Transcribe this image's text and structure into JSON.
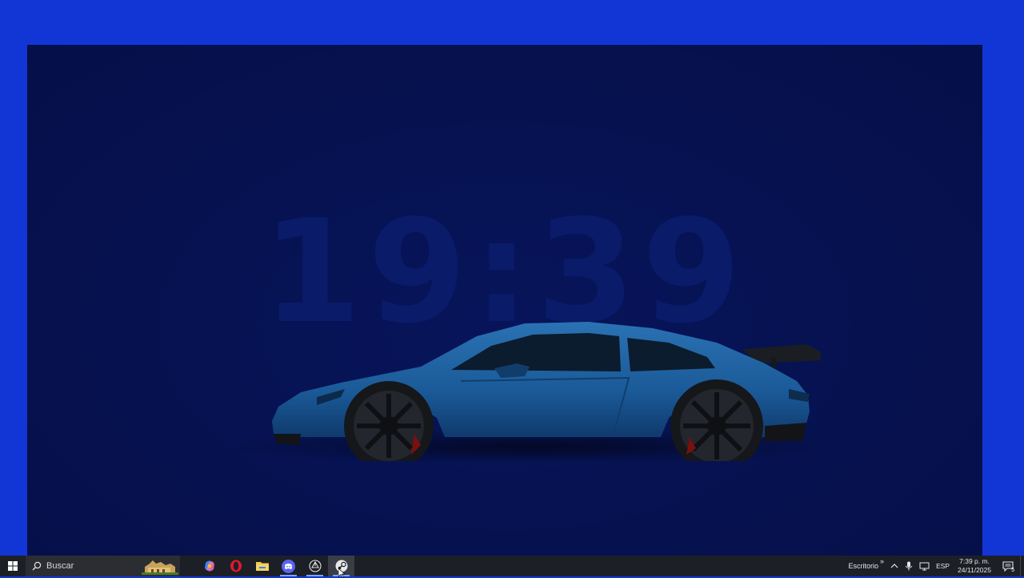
{
  "wallpaper": {
    "clock_text": "19:39",
    "subject": "blue sports car (side view)"
  },
  "taskbar": {
    "search_placeholder": "Buscar",
    "apps": [
      {
        "name": "copilot",
        "icon": "copilot-icon",
        "running": false
      },
      {
        "name": "opera",
        "icon": "opera-icon",
        "running": false
      },
      {
        "name": "file-explorer",
        "icon": "folder-icon",
        "running": false
      },
      {
        "name": "discord",
        "icon": "discord-icon",
        "running": true
      },
      {
        "name": "unity-hub",
        "icon": "unity-icon",
        "running": true
      },
      {
        "name": "steam",
        "icon": "steam-icon",
        "running": true,
        "active": true
      }
    ],
    "tray": {
      "desktop_label": "Escritorio",
      "chevron": "»",
      "language": "ESP",
      "time": "7:39 p. m.",
      "date": "24/11/2025",
      "notification_count": "5"
    }
  },
  "colors": {
    "desktop_bg": "#1236d6",
    "wallpaper_bg": "#061250",
    "taskbar_bg": "#1d1f26",
    "car_body": "#1d5e9c"
  }
}
